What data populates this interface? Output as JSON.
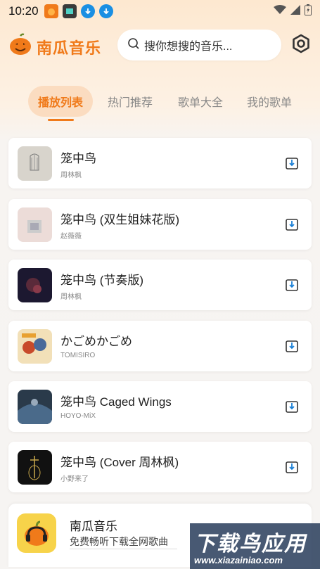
{
  "status_bar": {
    "time": "10:20"
  },
  "header": {
    "app_title": "南瓜音乐",
    "search_placeholder": "搜你想搜的音乐..."
  },
  "tabs": [
    {
      "label": "播放列表",
      "active": true
    },
    {
      "label": "热门推荐",
      "active": false
    },
    {
      "label": "歌单大全",
      "active": false
    },
    {
      "label": "我的歌单",
      "active": false
    }
  ],
  "songs": [
    {
      "title": "笼中鸟",
      "artist": "周林枫"
    },
    {
      "title": "笼中鸟 (双生姐妹花版)",
      "artist": "赵薇薇"
    },
    {
      "title": "笼中鸟 (节奏版)",
      "artist": "周林枫"
    },
    {
      "title": "かごめかごめ",
      "artist": "TOMISIRO"
    },
    {
      "title": "笼中鸟 Caged Wings",
      "artist": "HOYO-MiX"
    },
    {
      "title": "笼中鸟 (Cover 周林枫)",
      "artist": "小野来了"
    }
  ],
  "promo": {
    "title": "南瓜音乐",
    "subtitle": "免费畅听下载全网歌曲"
  },
  "watermark": {
    "big": "下载鸟应用",
    "small": "www.xiazainiao.com"
  },
  "colors": {
    "accent": "#f07a1a",
    "tab_active_bg": "#fbdcc0"
  }
}
